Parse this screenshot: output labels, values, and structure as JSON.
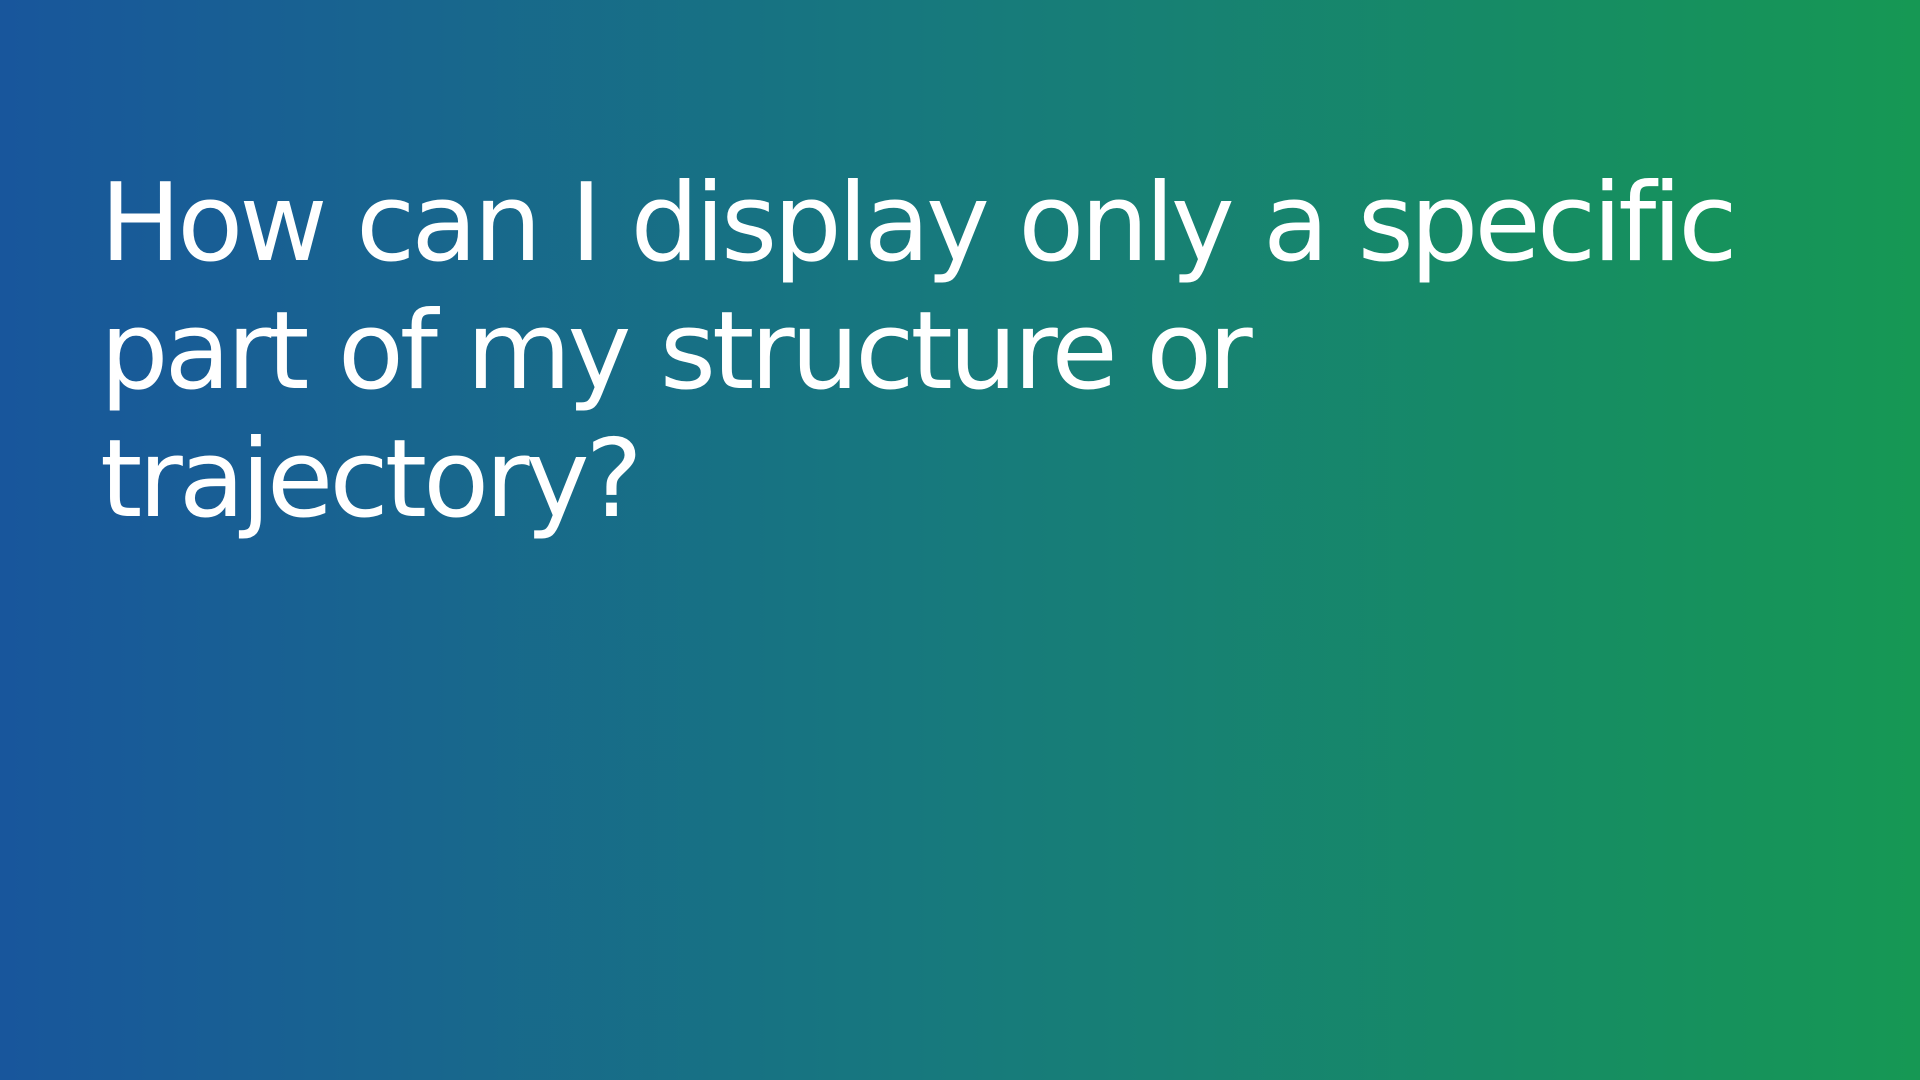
{
  "slide": {
    "title_lines": [
      "How can I display only a specific",
      "part of my structure or",
      "trajectory?"
    ]
  },
  "colors": {
    "gradient_start": "#18569c",
    "gradient_mid": "#177a7c",
    "gradient_end": "#169854",
    "text": "#ffffff"
  }
}
